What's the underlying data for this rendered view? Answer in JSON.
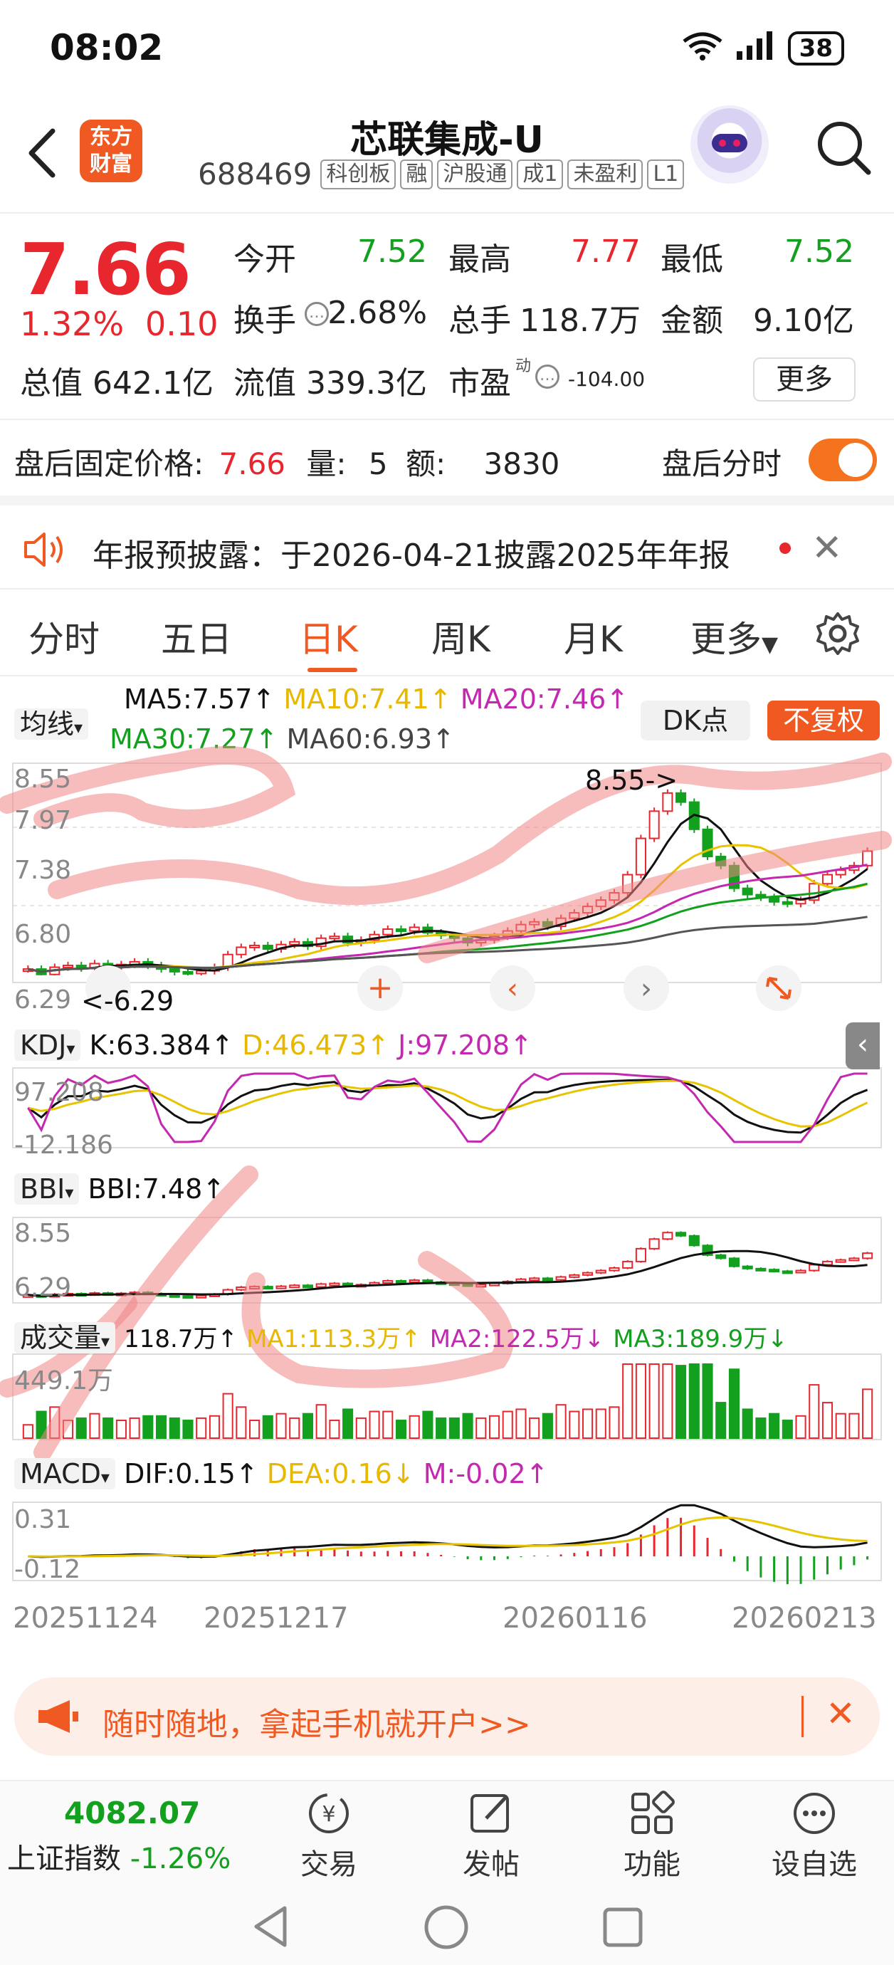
{
  "status": {
    "time": "08:02",
    "signal": "5A",
    "network": "7",
    "battery": "38"
  },
  "header": {
    "logo_line1": "东方",
    "logo_line2": "财富",
    "name": "芯联集成-U",
    "code": "688469",
    "tags": [
      "科创板",
      "融",
      "沪股通",
      "成1",
      "未盈利",
      "L1"
    ]
  },
  "quote": {
    "price": "7.66",
    "pct": "1.32%",
    "change": "0.10",
    "open_label": "今开",
    "open": "7.52",
    "high_label": "最高",
    "high": "7.77",
    "low_label": "最低",
    "low": "7.52",
    "turnover_label": "换手",
    "turnover": "2.68%",
    "volume_label": "总手",
    "volume": "118.7万",
    "amount_label": "金额",
    "amount": "9.10亿",
    "mktcap_label": "总值",
    "mktcap": "642.1亿",
    "float_label": "流值",
    "float": "339.3亿",
    "pe_label": "市盈",
    "pe_sup": "动",
    "pe": "-104.00",
    "more": "更多"
  },
  "afterhours": {
    "label": "盘后固定价格:",
    "price": "7.66",
    "vol_label": "量:",
    "vol": "5",
    "amt_label": "额:",
    "amt": "3830",
    "toggle_label": "盘后分时",
    "toggle_on": true
  },
  "notice": {
    "text": "年报预披露：于2026-04-21披露2025年年报"
  },
  "tabs": [
    "分时",
    "五日",
    "日K",
    "周K",
    "月K",
    "更多"
  ],
  "active_tab": "日K",
  "ma_legend": {
    "selector": "均线",
    "ma5": "MA5:7.57↑",
    "ma10": "MA10:7.41↑",
    "ma20": "MA20:7.46↑",
    "ma30": "MA30:7.27↑",
    "ma60": "MA60:6.93↑",
    "dk": "DK点",
    "fq": "不复权"
  },
  "kline_axis": {
    "t1": "8.55",
    "t2": "7.97",
    "t3": "7.38",
    "t4": "6.80",
    "t5": "6.29",
    "hi_mark": "8.55->",
    "lo_mark": "<-6.29"
  },
  "kdj": {
    "selector": "KDJ",
    "k": "K:63.384↑",
    "d": "D:46.473↑",
    "j": "J:97.208↑",
    "top": "97.208",
    "bottom": "-12.186"
  },
  "bbi": {
    "selector": "BBI",
    "bbi": "BBI:7.48↑",
    "top": "8.55",
    "bottom": "6.29"
  },
  "vol": {
    "selector": "成交量",
    "v": "118.7万↑",
    "ma1": "MA1:113.3万↑",
    "ma2": "MA2:122.5万↓",
    "ma3": "MA3:189.9万↓",
    "top": "449.1万"
  },
  "macd": {
    "selector": "MACD",
    "dif": "DIF:0.15↑",
    "dea": "DEA:0.16↓",
    "m": "M:-0.02↑",
    "top": "0.31",
    "bottom": "-0.12"
  },
  "dates": [
    "20251124",
    "20251217",
    "20260116",
    "20260213"
  ],
  "chart_data": {
    "type": "candlestick",
    "ylim": [
      6.29,
      8.55
    ],
    "closes": [
      6.36,
      6.3,
      6.38,
      6.4,
      6.37,
      6.42,
      6.39,
      6.41,
      6.44,
      6.4,
      6.36,
      6.33,
      6.31,
      6.34,
      6.38,
      6.52,
      6.6,
      6.62,
      6.58,
      6.63,
      6.66,
      6.61,
      6.7,
      6.72,
      6.65,
      6.68,
      6.74,
      6.8,
      6.78,
      6.82,
      6.76,
      6.73,
      6.7,
      6.65,
      6.68,
      6.72,
      6.78,
      6.85,
      6.88,
      6.83,
      6.92,
      6.98,
      7.05,
      7.12,
      7.2,
      7.4,
      7.8,
      8.1,
      8.3,
      8.2,
      7.9,
      7.6,
      7.5,
      7.25,
      7.18,
      7.15,
      7.1,
      7.08,
      7.12,
      7.3,
      7.4,
      7.45,
      7.5,
      7.66
    ],
    "colors": {
      "up": "#e8262d",
      "down": "#13a01f",
      "ma5": "#111111",
      "ma10": "#e8c400",
      "ma20": "#c428b0",
      "ma30": "#13a01f",
      "ma60": "#555555"
    }
  },
  "promo": {
    "text": "随时随地，拿起手机就开户>>"
  },
  "bottom": {
    "index_value": "4082.07",
    "index_name": "上证指数",
    "index_pct": "-1.26%",
    "trade": "交易",
    "post": "发帖",
    "func": "功能",
    "watch": "设自选"
  }
}
